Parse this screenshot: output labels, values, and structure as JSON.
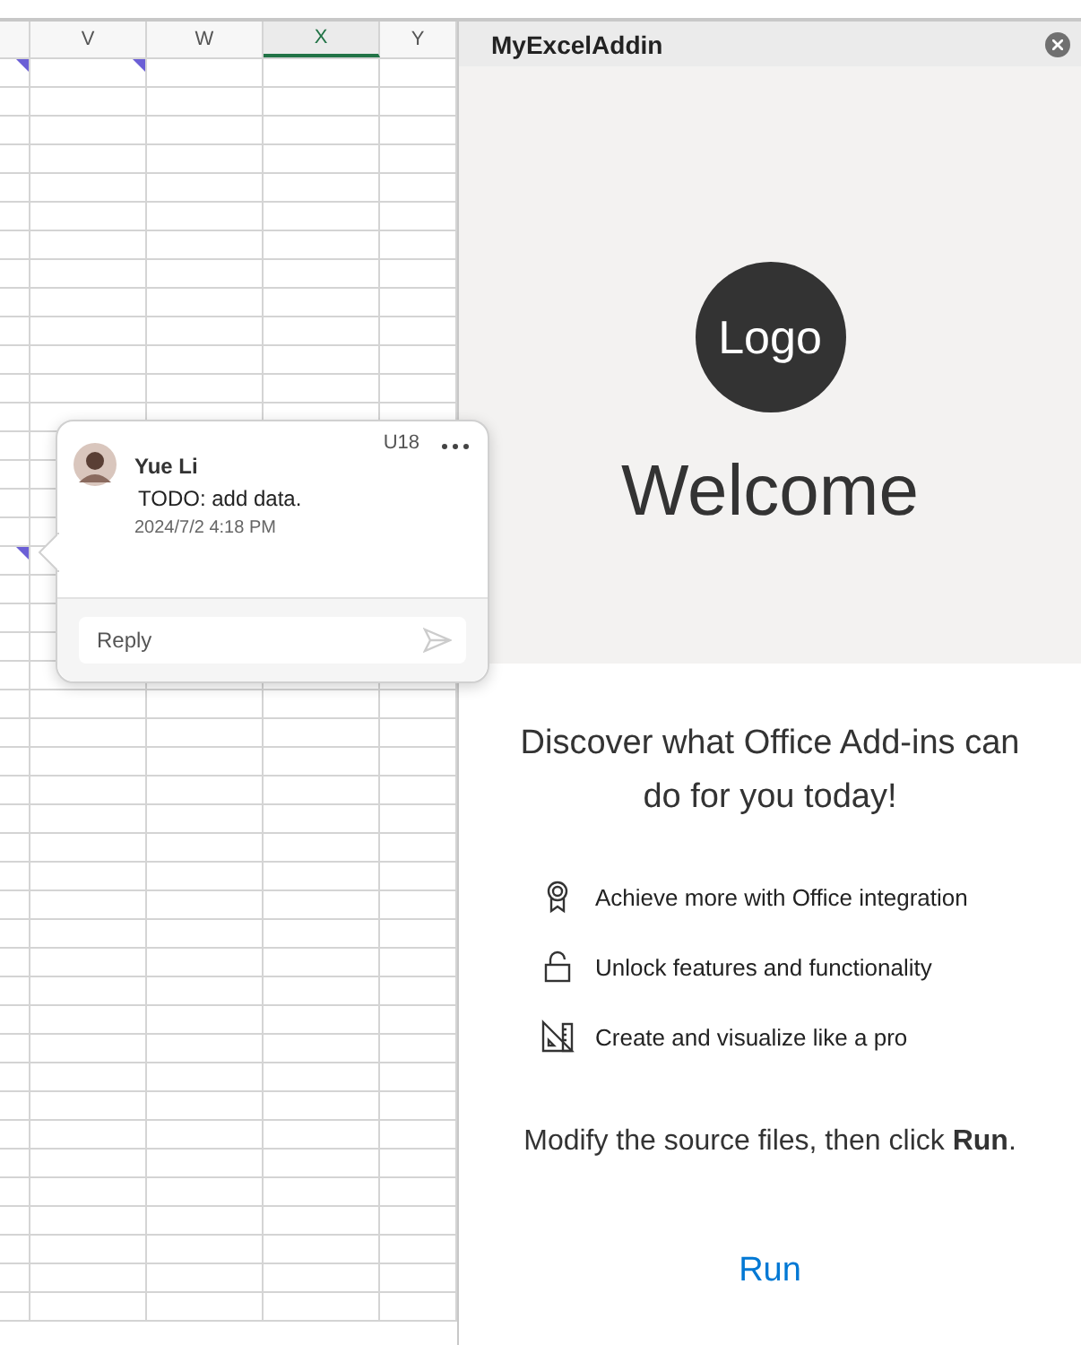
{
  "sheet": {
    "columns": [
      {
        "selected": false
      },
      {
        "label": "V",
        "selected": false
      },
      {
        "label": "W",
        "selected": false
      },
      {
        "label": "X",
        "selected": true
      },
      {
        "label": "Y",
        "selected": false
      }
    ]
  },
  "comment": {
    "cell": "U18",
    "author": "Yue Li",
    "text": "TODO: add data.",
    "date": "2024/7/2 4:18 PM",
    "reply_placeholder": "Reply"
  },
  "pane": {
    "title": "MyExcelAddin",
    "logo": "Logo",
    "welcome": "Welcome",
    "description": "Discover what Office Add-ins can do for you today!",
    "features": [
      {
        "kind": "ribbon",
        "text": "Achieve more with Office integration"
      },
      {
        "kind": "lock",
        "text": "Unlock features and functionality"
      },
      {
        "kind": "design",
        "text": "Create and visualize like a pro"
      }
    ],
    "instruction": "Modify the source files, then click **Run**.",
    "run_button": "Run"
  }
}
